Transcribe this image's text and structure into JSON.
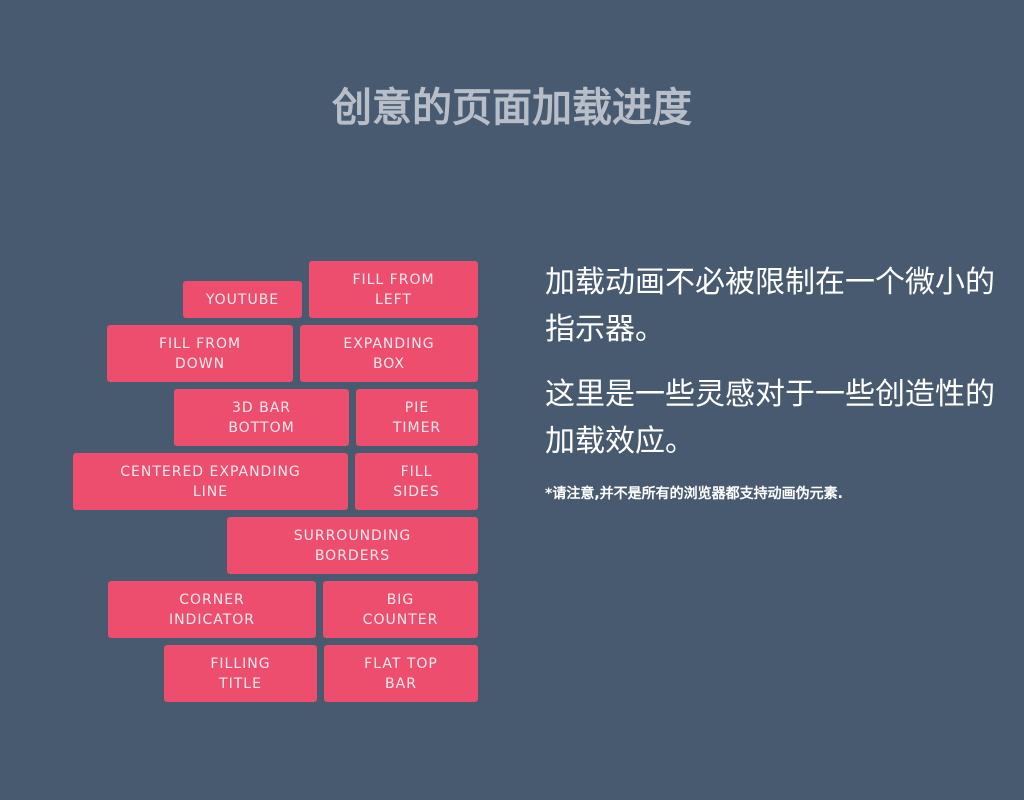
{
  "header": {
    "title": "创意的页面加载进度"
  },
  "buttons": [
    {
      "line1": "YOUTUBE",
      "line2": ""
    },
    {
      "line1": "FILL FROM",
      "line2": "LEFT"
    },
    {
      "line1": "FILL FROM",
      "line2": "DOWN"
    },
    {
      "line1": "EXPANDING",
      "line2": "BOX"
    },
    {
      "line1": "3D BAR",
      "line2": "BOTTOM"
    },
    {
      "line1": "PIE",
      "line2": "TIMER"
    },
    {
      "line1": "CENTERED EXPANDING",
      "line2": "LINE"
    },
    {
      "line1": "FILL",
      "line2": "SIDES"
    },
    {
      "line1": "SURROUNDING",
      "line2": "BORDERS"
    },
    {
      "line1": "CORNER",
      "line2": "INDICATOR"
    },
    {
      "line1": "BIG",
      "line2": "COUNTER"
    },
    {
      "line1": "FILLING",
      "line2": "TITLE"
    },
    {
      "line1": "FLAT TOP",
      "line2": "BAR"
    }
  ],
  "description": {
    "paragraph1": "加载动画不必被限制在一个微小的指示器。",
    "paragraph2": "这里是一些灵感对于一些创造性的加载效应。",
    "note": "*请注意,并不是所有的浏览器都支持动画伪元素."
  },
  "colors": {
    "background": "#485a70",
    "button": "#ed4e6e",
    "title": "#b7bec8"
  }
}
